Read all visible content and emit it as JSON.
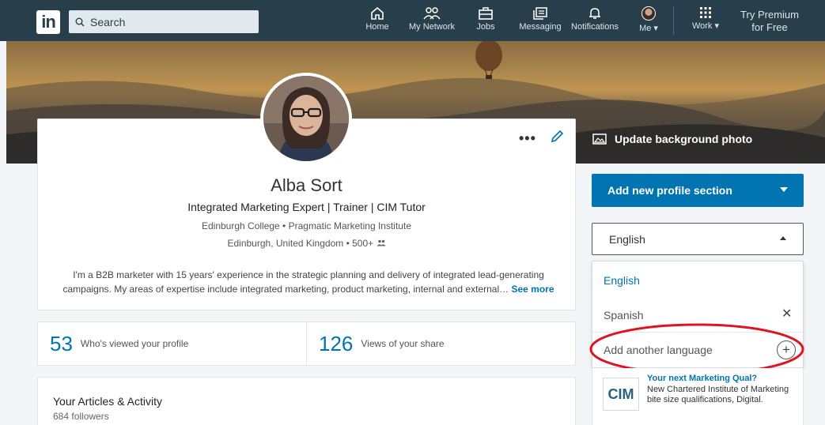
{
  "nav": {
    "search_placeholder": "Search",
    "items": [
      {
        "label": "Home",
        "icon": "home-icon"
      },
      {
        "label": "My Network",
        "icon": "network-icon"
      },
      {
        "label": "Jobs",
        "icon": "briefcase-icon"
      },
      {
        "label": "Messaging",
        "icon": "messaging-icon"
      },
      {
        "label": "Notifications",
        "icon": "bell-icon"
      },
      {
        "label": "Me ▾",
        "icon": "avatar"
      },
      {
        "label": "Work ▾",
        "icon": "grid-icon"
      }
    ],
    "premium_line1": "Try Premium",
    "premium_line2": "for Free"
  },
  "profile": {
    "name": "Alba Sort",
    "headline": "Integrated Marketing Expert | Trainer | CIM Tutor",
    "education": "Edinburgh College • Pragmatic Marketing Institute",
    "location": "Edinburgh, United Kingdom • 500+",
    "summary_line1": "I'm a B2B marketer with 15 years' experience in the strategic planning and delivery of integrated lead-generating",
    "summary_line2": "campaigns. My areas of expertise include integrated marketing, product marketing, internal and external…",
    "see_more": "See more"
  },
  "stats": [
    {
      "value": "53",
      "label": "Who's viewed your profile"
    },
    {
      "value": "126",
      "label": "Views of your share"
    }
  ],
  "articles": {
    "title": "Your Articles & Activity",
    "followers": "684 followers"
  },
  "right_rail": {
    "update_bg": "Update background photo",
    "add_section": "Add new profile section",
    "language_selected": "English",
    "language_options": [
      "English",
      "Spanish"
    ],
    "add_language": "Add another language"
  },
  "ad": {
    "logo_text": "CIM",
    "title": "Your next Marketing Qual?",
    "body": "New Chartered Institute of Marketing bite size qualifications, Digital."
  },
  "colors": {
    "nav_bg": "#283e4a",
    "accent": "#0073b1",
    "highlight": "#e0141e"
  }
}
